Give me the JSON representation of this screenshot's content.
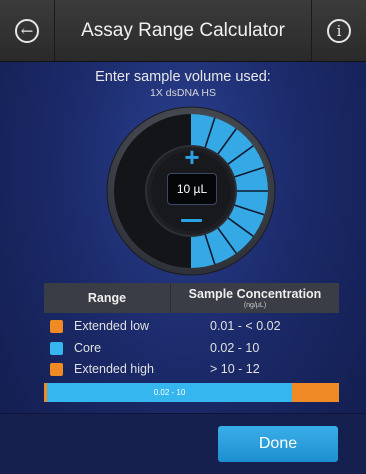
{
  "header": {
    "title": "Assay Range Calculator",
    "back_icon": "←",
    "info_icon": "i"
  },
  "prompt": "Enter sample volume used:",
  "assay_name": "1X dsDNA HS",
  "volume": {
    "value": "10 µL",
    "plus": "+",
    "segments_filled": 10,
    "segments_total": 10
  },
  "table": {
    "col_range": "Range",
    "col_conc": "Sample Concentration",
    "col_conc_unit": "(ng/µL)",
    "rows": [
      {
        "label": "Extended low",
        "value": "0.01  -  < 0.02",
        "color": "#f08a24"
      },
      {
        "label": "Core",
        "value": "0.02  -  10",
        "color": "#35b6ee"
      },
      {
        "label": "Extended high",
        "value": "> 10  -  12",
        "color": "#f08a24"
      }
    ]
  },
  "range_bar": {
    "core_label": "0.02 - 10"
  },
  "done_label": "Done",
  "colors": {
    "accent": "#35b6ee",
    "extended": "#f08a24"
  }
}
